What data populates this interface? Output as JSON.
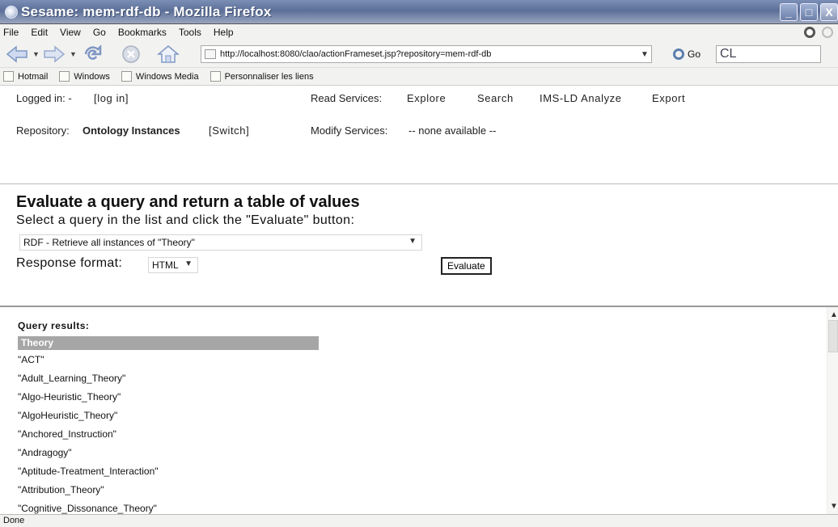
{
  "window": {
    "title": "Sesame: mem-rdf-db - Mozilla Firefox",
    "minimize_glyph": "_",
    "maximize_glyph": "□",
    "close_glyph": "X"
  },
  "menu": [
    "File",
    "Edit",
    "View",
    "Go",
    "Bookmarks",
    "Tools",
    "Help"
  ],
  "toolbar": {
    "url": "http://localhost:8080/clao/actionFrameset.jsp?repository=mem-rdf-db",
    "go_label": "Go",
    "search_text": "CL"
  },
  "bookmarks": [
    "Hotmail",
    "Windows",
    "Windows Media",
    "Personnaliser les liens"
  ],
  "header": {
    "logged_in_label": "Logged in: -",
    "login_link": "[log in]",
    "read_services_label": "Read Services:",
    "read_services": [
      "Explore",
      "Search",
      "IMS-LD Analyze",
      "Export"
    ],
    "repository_label": "Repository:",
    "repository_name": "Ontology Instances",
    "switch_link": "[Switch]",
    "modify_services_label": "Modify Services:",
    "modify_services_value": "-- none available --"
  },
  "query": {
    "heading": "Evaluate a query and return a table of values",
    "instruction": "Select a query in the list and click the \"Evaluate\" button:",
    "selected_query": "RDF - Retrieve all instances of \"Theory\"",
    "response_format_label": "Response format:",
    "response_format_value": "HTML",
    "evaluate_label": "Evaluate"
  },
  "results": {
    "title": "Query results:",
    "column": "Theory",
    "rows": [
      "\"ACT\"",
      "\"Adult_Learning_Theory\"",
      "\"Algo-Heuristic_Theory\"",
      "\"AlgoHeuristic_Theory\"",
      "\"Anchored_Instruction\"",
      "\"Andragogy\"",
      "\"Aptitude-Treatment_Interaction\"",
      "\"Attribution_Theory\"",
      "\"Cognitive_Dissonance_Theory\""
    ]
  },
  "status": "Done"
}
